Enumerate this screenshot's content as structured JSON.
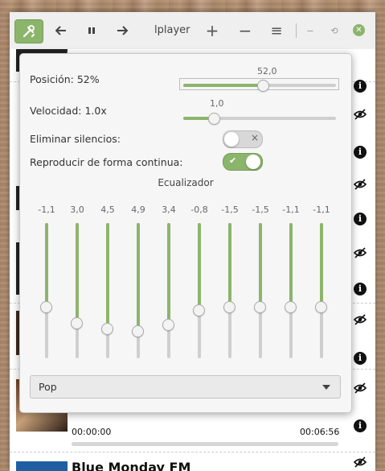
{
  "window": {
    "title": "lplayer",
    "buttons": {
      "tools_icon": "tools-icon",
      "previous_icon": "previous-icon",
      "pause_icon": "pause-icon",
      "next_icon": "next-icon",
      "add_symbol": "+",
      "remove_symbol": "−",
      "menu_symbol": "≡",
      "minimize_symbol": "−",
      "restore_symbol": "⟲",
      "close_symbol": "✕"
    },
    "accent_color": "#8cb56c"
  },
  "list": {
    "current_time": "00:00:00",
    "total_time": "00:06:56",
    "progress": 0,
    "now_playing_title": "Blue Monday FM",
    "row_icons": [
      "info-icon",
      "hidden-icon",
      "info-icon",
      "hidden-icon",
      "info-icon",
      "hidden-icon",
      "info-icon",
      "hidden-icon",
      "info-icon",
      "hidden-icon",
      "info-icon",
      "hidden-icon"
    ]
  },
  "popover": {
    "position_label": "Posición: 52%",
    "position_value_text": "52,0",
    "position_value": 52.0,
    "speed_label": "Velocidad: 1.0x",
    "speed_value_text": "1,0",
    "speed_fraction": 0.2,
    "remove_silences_label": "Eliminar silencios:",
    "remove_silences": false,
    "remove_silences_off_glyph": "×",
    "continuous_label": "Reproducir de forma continua:",
    "continuous": true,
    "continuous_on_glyph": "✔",
    "equalizer_title": "Ecualizador",
    "equalizer_values": [
      "-1,1",
      "3,0",
      "4,5",
      "4,9",
      "3,4",
      "-0,8",
      "-1,5",
      "-1,5",
      "-1,1",
      "-1,1"
    ],
    "equalizer_fractions": [
      0.62,
      0.74,
      0.78,
      0.8,
      0.75,
      0.64,
      0.62,
      0.62,
      0.62,
      0.62
    ],
    "preset": "Pop"
  }
}
